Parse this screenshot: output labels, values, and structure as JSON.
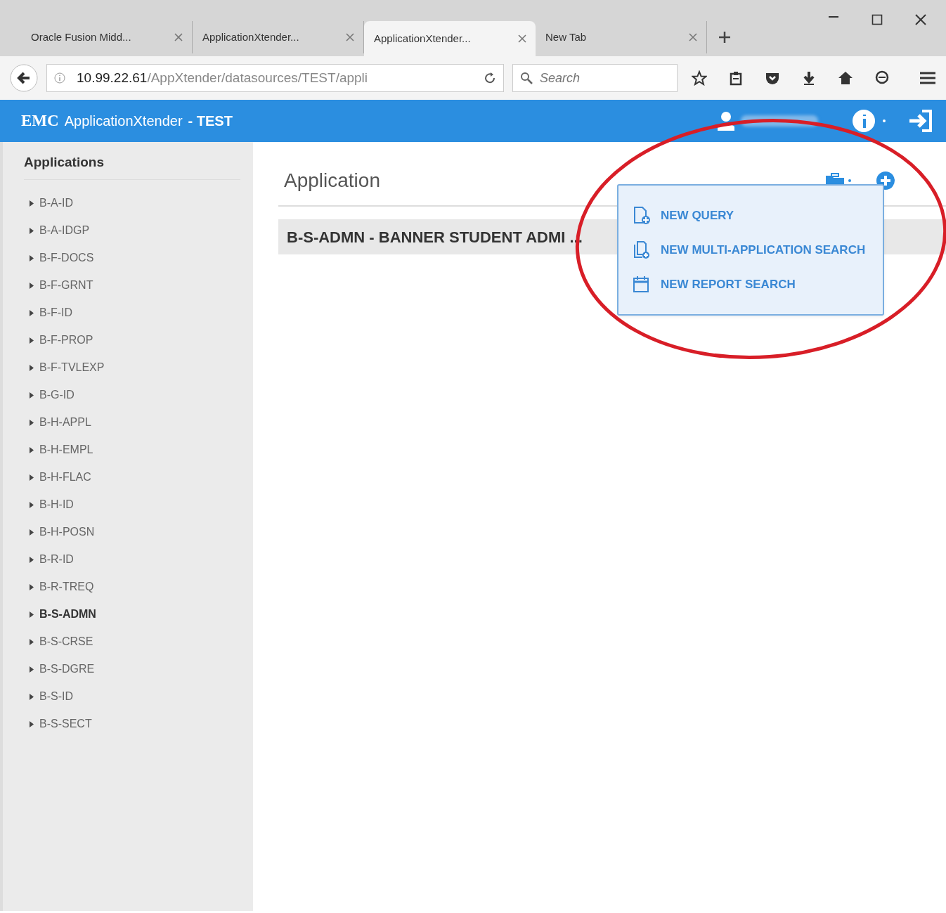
{
  "browser": {
    "tabs": [
      {
        "title": "Oracle Fusion Midd...",
        "selected": false
      },
      {
        "title": "ApplicationXtender...",
        "selected": false
      },
      {
        "title": "ApplicationXtender...",
        "selected": true
      },
      {
        "title": "New Tab",
        "selected": false
      }
    ],
    "url": {
      "host": "10.99.22.61",
      "path": "/AppXtender/datasources/TEST/appli"
    },
    "search": {
      "placeholder": "Search"
    }
  },
  "app": {
    "brand": "EMC",
    "title": "ApplicationXtender",
    "suffix": "- TEST"
  },
  "sidebar": {
    "heading": "Applications",
    "items": [
      {
        "label": "B-A-ID",
        "selected": false
      },
      {
        "label": "B-A-IDGP",
        "selected": false
      },
      {
        "label": "B-F-DOCS",
        "selected": false
      },
      {
        "label": "B-F-GRNT",
        "selected": false
      },
      {
        "label": "B-F-ID",
        "selected": false
      },
      {
        "label": "B-F-PROP",
        "selected": false
      },
      {
        "label": "B-F-TVLEXP",
        "selected": false
      },
      {
        "label": "B-G-ID",
        "selected": false
      },
      {
        "label": "B-H-APPL",
        "selected": false
      },
      {
        "label": "B-H-EMPL",
        "selected": false
      },
      {
        "label": "B-H-FLAC",
        "selected": false
      },
      {
        "label": "B-H-ID",
        "selected": false
      },
      {
        "label": "B-H-POSN",
        "selected": false
      },
      {
        "label": "B-R-ID",
        "selected": false
      },
      {
        "label": "B-R-TREQ",
        "selected": false
      },
      {
        "label": "B-S-ADMN",
        "selected": true
      },
      {
        "label": "B-S-CRSE",
        "selected": false
      },
      {
        "label": "B-S-DGRE",
        "selected": false
      },
      {
        "label": "B-S-ID",
        "selected": false
      },
      {
        "label": "B-S-SECT",
        "selected": false
      }
    ]
  },
  "main": {
    "heading": "Application",
    "rows": [
      {
        "label": "B-S-ADMN - BANNER STUDENT ADMI ..."
      }
    ]
  },
  "menu": {
    "items": [
      {
        "label": "NEW QUERY",
        "kind": "query"
      },
      {
        "label": "NEW MULTI-APPLICATION SEARCH",
        "kind": "multi"
      },
      {
        "label": "NEW REPORT SEARCH",
        "kind": "report"
      }
    ]
  },
  "annotation": {
    "kind": "ellipse"
  }
}
